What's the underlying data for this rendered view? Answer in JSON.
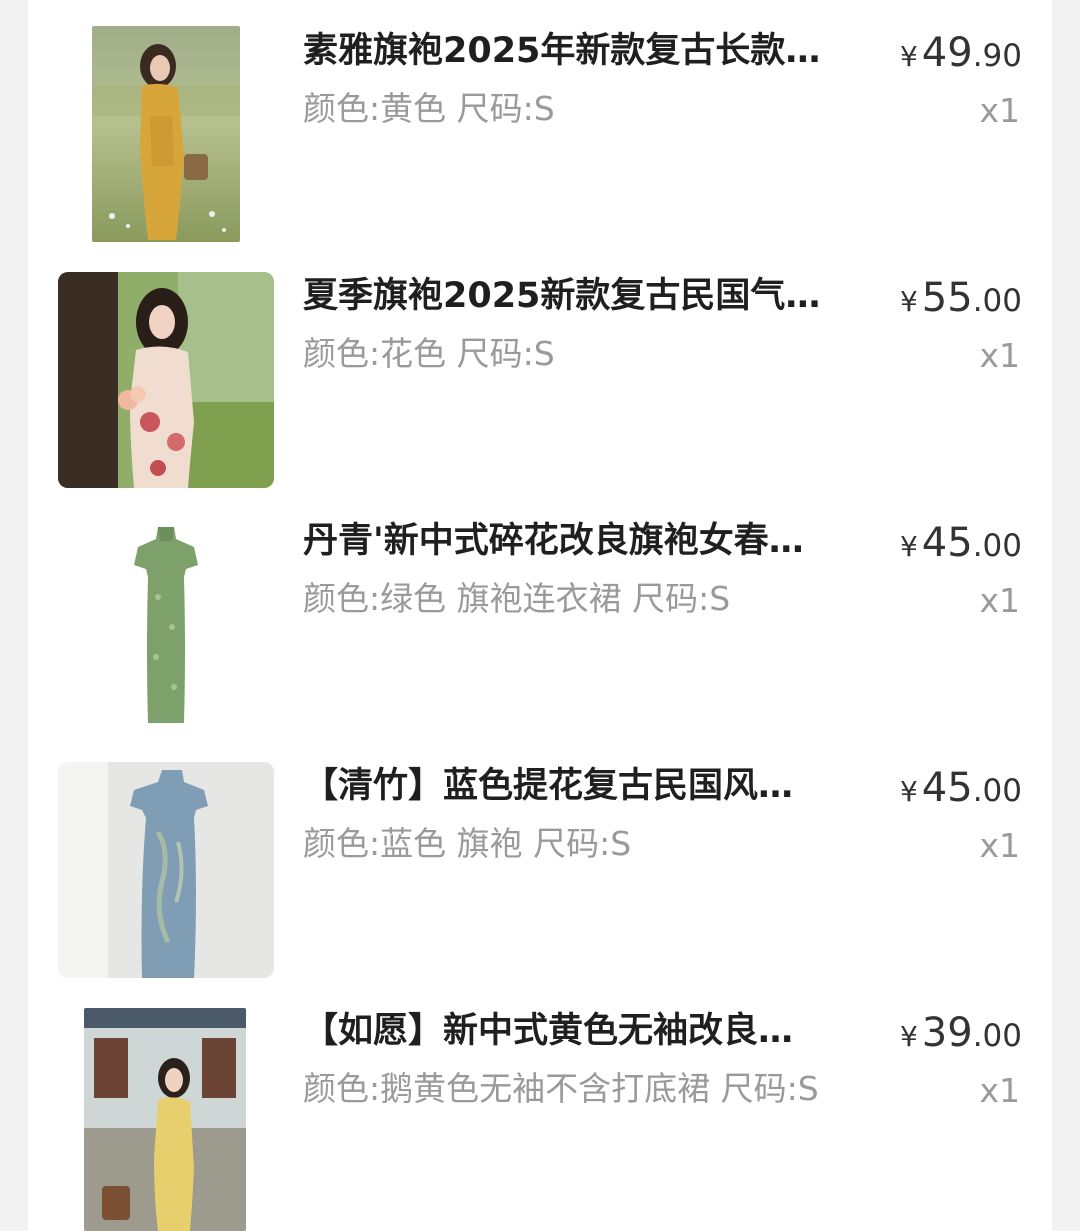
{
  "order_items": [
    {
      "title": "素雅旗袍2025年新款复古长款…",
      "spec": "颜色:黄色 尺码:S",
      "currency": "¥",
      "price_int": "49",
      "price_dec": ".90",
      "qty": "x1",
      "image_desc": "yellow-qipao-model-photo"
    },
    {
      "title": "夏季旗袍2025新款复古民国气…",
      "spec": "颜色:花色 尺码:S",
      "currency": "¥",
      "price_int": "55",
      "price_dec": ".00",
      "qty": "x1",
      "image_desc": "floral-qipao-model-photo"
    },
    {
      "title": "丹青'新中式碎花改良旗袍女春…",
      "spec": "颜色:绿色 旗袍连衣裙 尺码:S",
      "currency": "¥",
      "price_int": "45",
      "price_dec": ".00",
      "qty": "x1",
      "image_desc": "green-qipao-product-photo"
    },
    {
      "title": "【清竹】蓝色提花复古民国风…",
      "spec": "颜色:蓝色 旗袍 尺码:S",
      "currency": "¥",
      "price_int": "45",
      "price_dec": ".00",
      "qty": "x1",
      "image_desc": "blue-qipao-mannequin-photo"
    },
    {
      "title": "【如愿】新中式黄色无袖改良…",
      "spec": "颜色:鹅黄色无袖不含打底裙 尺码:S",
      "currency": "¥",
      "price_int": "39",
      "price_dec": ".00",
      "qty": "x1",
      "image_desc": "sleeveless-yellow-qipao-model-photo"
    }
  ],
  "colors": {
    "title": "#1f1f1f",
    "secondary": "#9a9a9a",
    "price": "#333333",
    "background": "#f2f2f2",
    "card": "#ffffff"
  }
}
